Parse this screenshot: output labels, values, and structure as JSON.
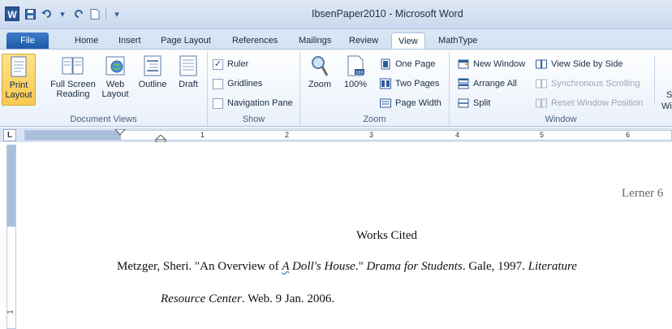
{
  "window": {
    "title": "IbsenPaper2010 - Microsoft Word",
    "app_icon_letter": "W"
  },
  "tabs": [
    {
      "label": "File"
    },
    {
      "label": "Home"
    },
    {
      "label": "Insert"
    },
    {
      "label": "Page Layout"
    },
    {
      "label": "References"
    },
    {
      "label": "Mailings"
    },
    {
      "label": "Review"
    },
    {
      "label": "View"
    },
    {
      "label": "MathType"
    }
  ],
  "ribbon": {
    "document_views": {
      "label": "Document Views",
      "buttons": [
        {
          "line1": "Print",
          "line2": "Layout"
        },
        {
          "line1": "Full Screen",
          "line2": "Reading"
        },
        {
          "line1": "Web",
          "line2": "Layout"
        },
        {
          "line1": "Outline",
          "line2": ""
        },
        {
          "line1": "Draft",
          "line2": ""
        }
      ]
    },
    "show": {
      "label": "Show",
      "items": [
        {
          "label": "Ruler",
          "checked": true
        },
        {
          "label": "Gridlines",
          "checked": false
        },
        {
          "label": "Navigation Pane",
          "checked": false
        }
      ]
    },
    "zoom": {
      "label": "Zoom",
      "zoom_btn": "Zoom",
      "hundred_btn": "100%",
      "one_page": "One Page",
      "two_pages": "Two Pages",
      "page_width": "Page Width"
    },
    "window": {
      "label": "Window",
      "new_window": "New Window",
      "arrange_all": "Arrange All",
      "split": "Split",
      "view_side_by_side": "View Side by Side",
      "synchronous_scrolling": "Synchronous Scrolling",
      "reset_window_position": "Reset Window Position",
      "switch_windows_partial_1": "S",
      "switch_windows_partial_2": "Wi"
    }
  },
  "ruler": {
    "corner": "L",
    "numbers": [
      "1",
      "2",
      "3",
      "4",
      "5",
      "6"
    ],
    "vertical_number": "1"
  },
  "document": {
    "header": "Lerner 6",
    "heading": "Works Cited",
    "citation": {
      "part1": "Metzger, Sheri. \"An Overview of ",
      "title_a": "A",
      "title_rest": " Doll's House",
      "part2": ".\" ",
      "journal": "Drama for Students",
      "part3": ". Gale, 1997. ",
      "database1": "Literature",
      "database2": "Resource Center",
      "part4": ". Web. 9 Jan. 2006."
    }
  }
}
